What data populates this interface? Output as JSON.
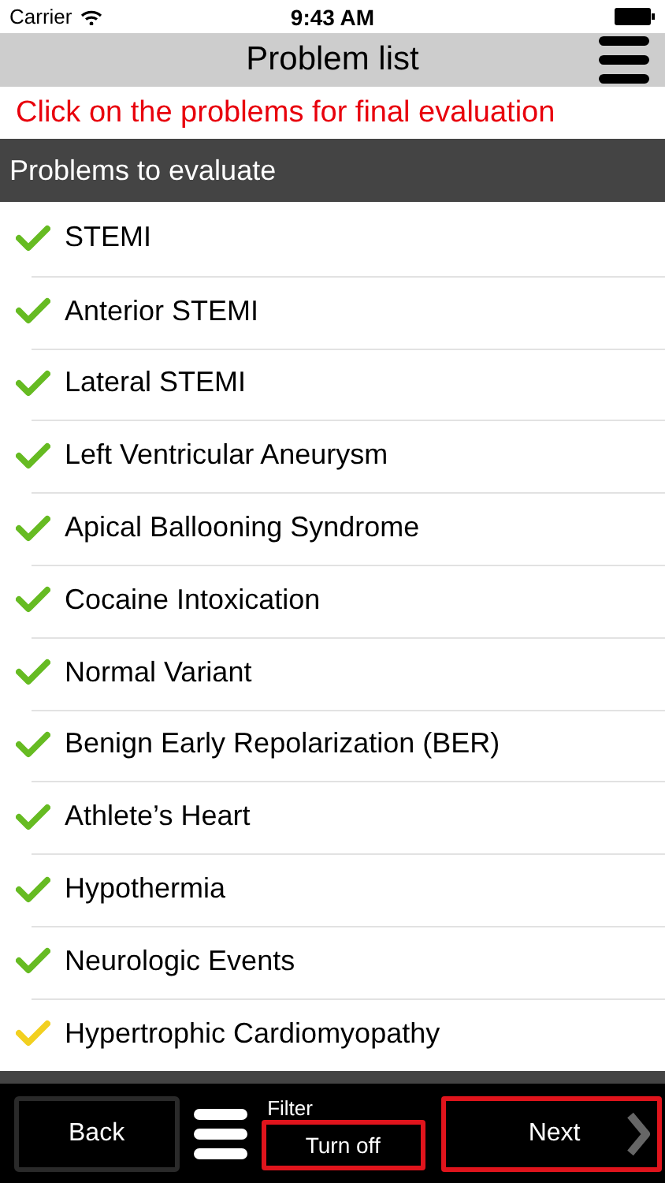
{
  "status_bar": {
    "carrier": "Carrier",
    "time": "9:43 AM"
  },
  "nav_bar": {
    "title": "Problem list"
  },
  "instruction": "Click on the problems for final evaluation",
  "section": {
    "title": "Problems to evaluate",
    "items": [
      {
        "label": "STEMI",
        "color": "#66bb22"
      },
      {
        "label": "Anterior STEMI",
        "color": "#66bb22"
      },
      {
        "label": "Lateral STEMI",
        "color": "#66bb22"
      },
      {
        "label": "Left Ventricular Aneurysm",
        "color": "#66bb22"
      },
      {
        "label": "Apical Ballooning Syndrome",
        "color": "#66bb22"
      },
      {
        "label": "Cocaine Intoxication",
        "color": "#66bb22"
      },
      {
        "label": "Normal Variant",
        "color": "#66bb22"
      },
      {
        "label": "Benign Early Repolarization (BER)",
        "color": "#66bb22"
      },
      {
        "label": "Athlete’s Heart",
        "color": "#66bb22"
      },
      {
        "label": "Hypothermia",
        "color": "#66bb22"
      },
      {
        "label": "Neurologic Events",
        "color": "#66bb22"
      },
      {
        "label": "Hypertrophic Cardiomyopathy",
        "color": "#f2d020"
      }
    ]
  },
  "toolbar": {
    "back": "Back",
    "filter_label": "Filter",
    "filter_button": "Turn off",
    "next": "Next"
  }
}
